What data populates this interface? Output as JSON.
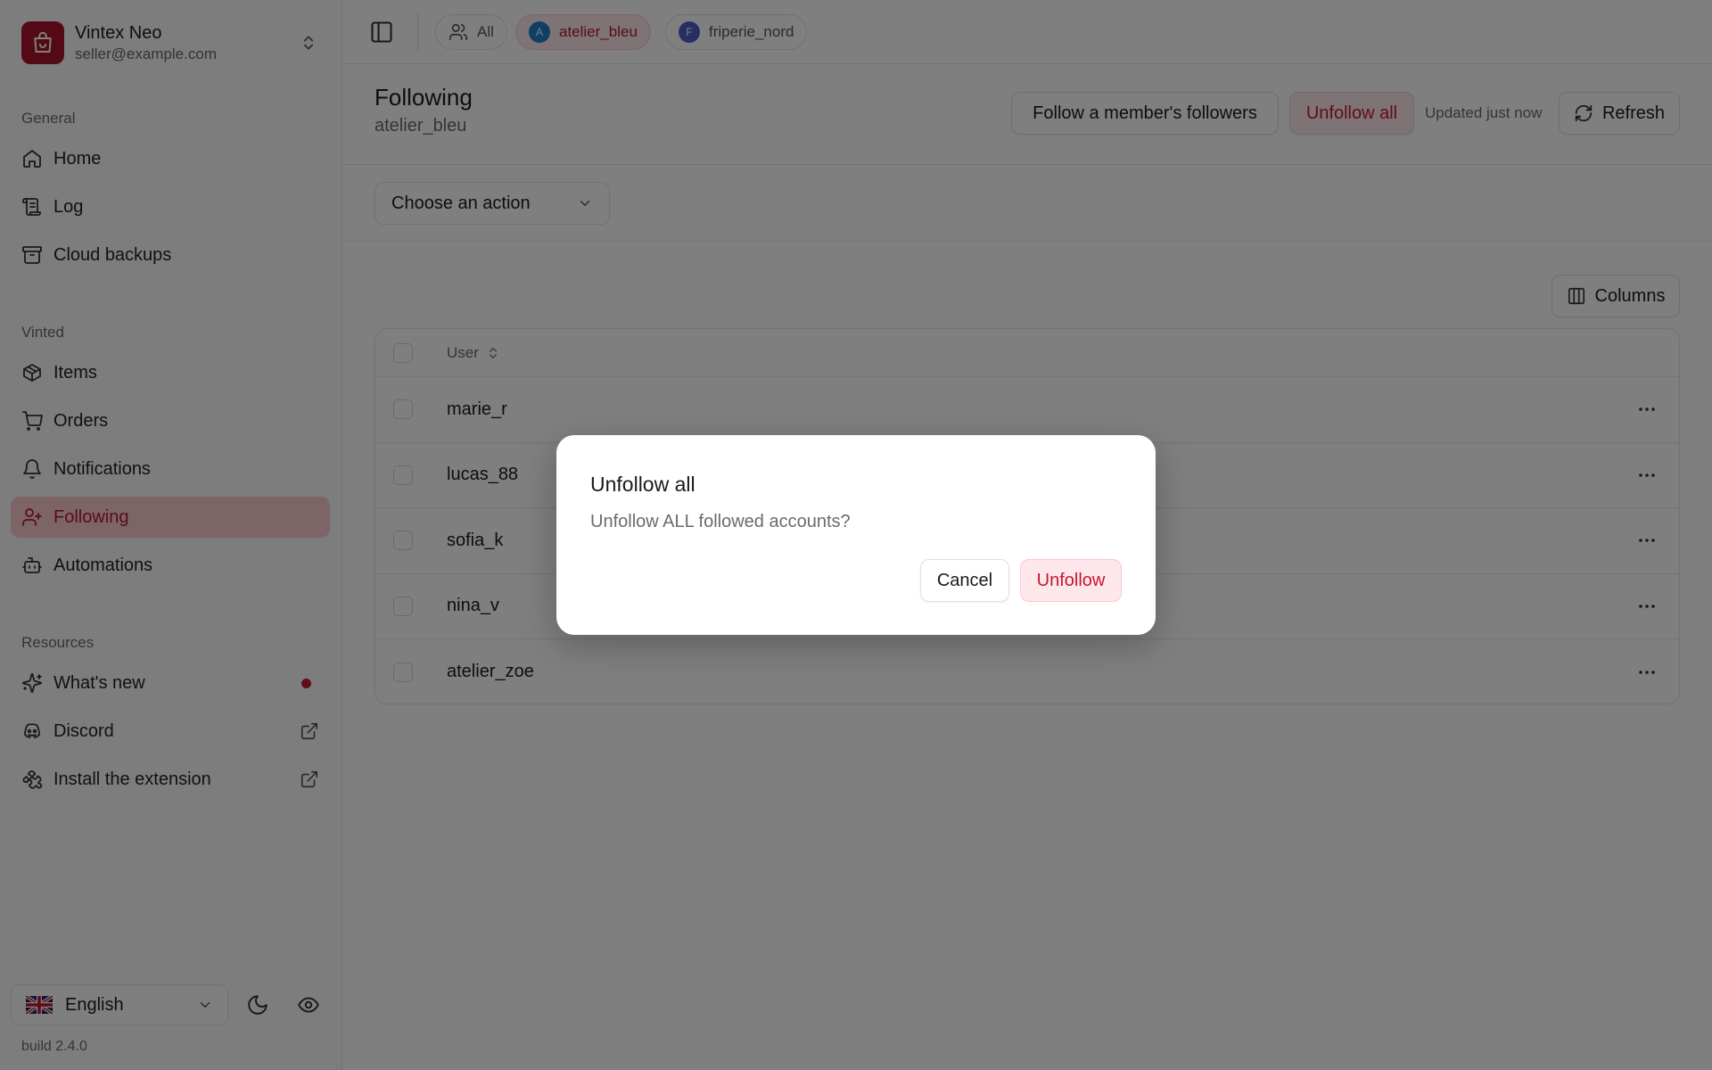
{
  "account": {
    "name": "Vintex Neo",
    "email": "seller@example.com"
  },
  "sections": {
    "general": "General",
    "vinted": "Vinted",
    "resources": "Resources"
  },
  "nav": {
    "home": "Home",
    "log": "Log",
    "backups": "Cloud backups",
    "items": "Items",
    "orders": "Orders",
    "notifications": "Notifications",
    "following": "Following",
    "automations": "Automations",
    "whats_new": "What's new",
    "discord": "Discord",
    "extension": "Install the extension"
  },
  "language": "English",
  "build": "build 2.4.0",
  "topbar": {
    "pills": [
      {
        "label": "All"
      },
      {
        "label": "atelier_bleu",
        "initial": "A"
      },
      {
        "label": "friperie_nord",
        "initial": "F"
      }
    ]
  },
  "page": {
    "title": "Following",
    "subtitle": "atelier_bleu",
    "follow_btn": "Follow a member's followers",
    "unfollow_all_btn": "Unfollow all",
    "updated": "Updated just now",
    "refresh_btn": "Refresh",
    "action_select": "Choose an action",
    "columns_btn": "Columns"
  },
  "table": {
    "header": "User",
    "rows": [
      "marie_r",
      "lucas_88",
      "sofia_k",
      "nina_v",
      "atelier_zoe"
    ]
  },
  "dialog": {
    "title": "Unfollow all",
    "message": "Unfollow ALL followed accounts?",
    "cancel": "Cancel",
    "confirm": "Unfollow"
  },
  "colors": {
    "accent": "#b4182e",
    "accent_bg": "#fde7ea",
    "avatar_a": "#1f7fc4",
    "avatar_f": "#4a5fc8"
  }
}
